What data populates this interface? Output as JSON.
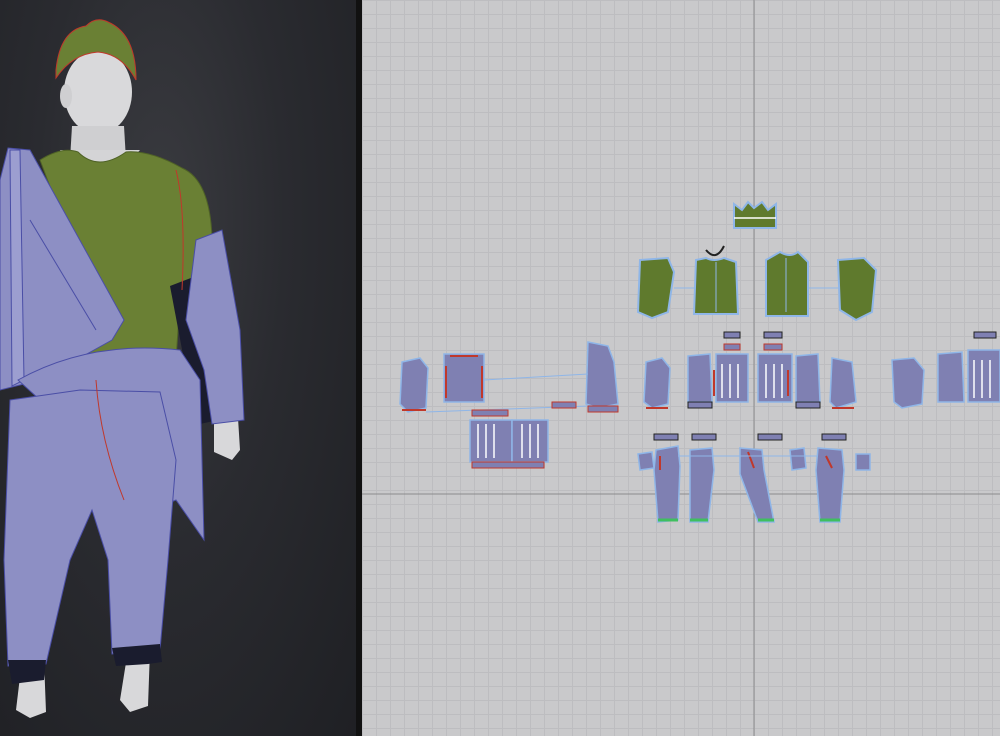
{
  "colors": {
    "garment_top": "#6a8034",
    "garment_bottom": "#8d8fc4",
    "pattern_purple": "#7f80b2",
    "pattern_green": "#5f7a2d",
    "seam_red": "#c0382b",
    "outline_blue": "#8fb6e8",
    "avatar_skin": "#d6d6d8",
    "grid_bg": "#c9c9cb"
  },
  "panels": {
    "left": "3d-viewport",
    "right": "2d-pattern-window"
  }
}
